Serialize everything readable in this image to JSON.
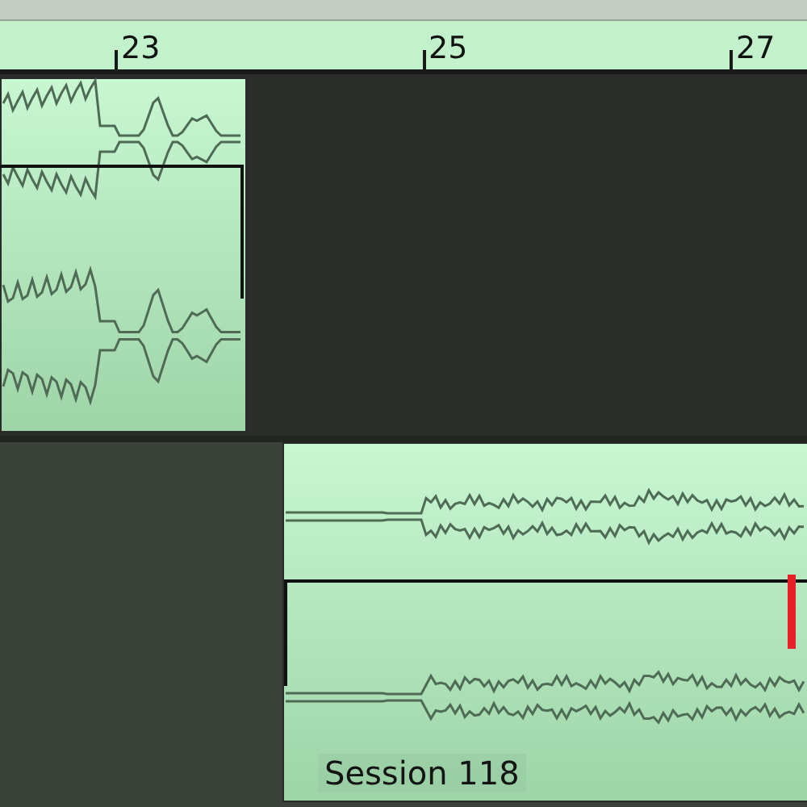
{
  "ruler": {
    "ticks": [
      {
        "label": "23"
      },
      {
        "label": "25"
      },
      {
        "label": "27"
      }
    ]
  },
  "tracks": [
    {
      "clips": [
        {
          "kind": "fade"
        }
      ]
    },
    {
      "clips": [
        {
          "kind": "steady",
          "label": "Session 118",
          "cursor": true
        }
      ]
    }
  ]
}
